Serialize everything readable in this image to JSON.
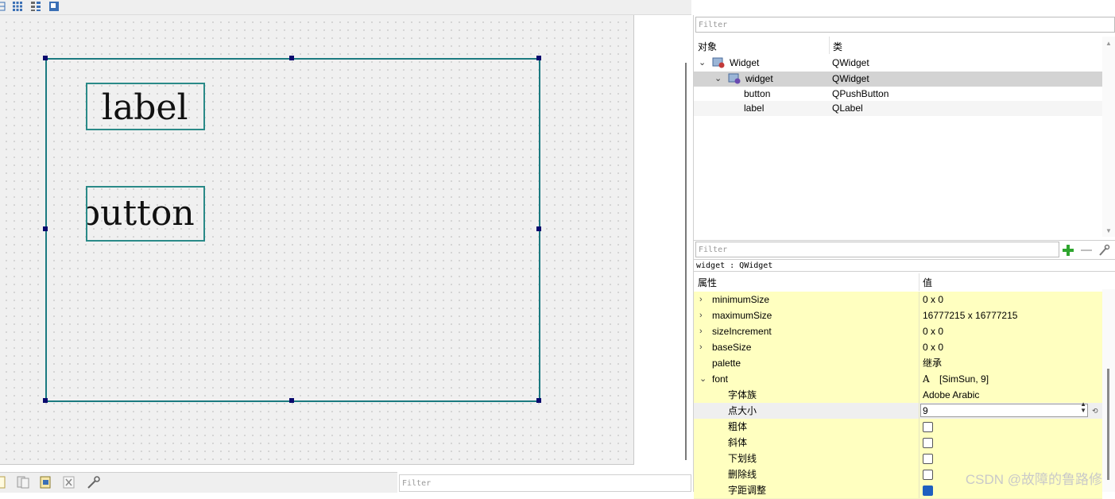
{
  "canvas": {
    "label_text": "label",
    "button_text": "button"
  },
  "object_inspector": {
    "filter_placeholder": "Filter",
    "col_object": "对象",
    "col_class": "类",
    "rows": [
      {
        "name": "Widget",
        "class": "QWidget"
      },
      {
        "name": "widget",
        "class": "QWidget"
      },
      {
        "name": "button",
        "class": "QPushButton"
      },
      {
        "name": "label",
        "class": "QLabel"
      }
    ]
  },
  "property_editor": {
    "filter_placeholder": "Filter",
    "context": "widget : QWidget",
    "col_property": "属性",
    "col_value": "值",
    "rows": [
      {
        "name": "minimumSize",
        "value": "0 x 0"
      },
      {
        "name": "maximumSize",
        "value": "16777215 x 16777215"
      },
      {
        "name": "sizeIncrement",
        "value": "0 x 0"
      },
      {
        "name": "baseSize",
        "value": "0 x 0"
      },
      {
        "name": "palette",
        "value": "继承"
      },
      {
        "name": "font",
        "value": "[SimSun, 9]",
        "value_prefix": "A"
      },
      {
        "name": "字体族",
        "value": "Adobe Arabic"
      },
      {
        "name": "点大小",
        "value": "9"
      },
      {
        "name": "粗体",
        "checked": false
      },
      {
        "name": "斜体",
        "checked": false
      },
      {
        "name": "下划线",
        "checked": false
      },
      {
        "name": "删除线",
        "checked": false
      },
      {
        "name": "字距调整",
        "checked": true
      }
    ]
  },
  "bottom": {
    "filter_placeholder": "Filter"
  },
  "watermark": "CSDN @故障的鲁路修",
  "colors": {
    "form_border": "#1b7a80",
    "property_row_bg": "#ffffc0",
    "selected_row_bg": "#d3d3d3",
    "handle": "#0a0a6e"
  }
}
